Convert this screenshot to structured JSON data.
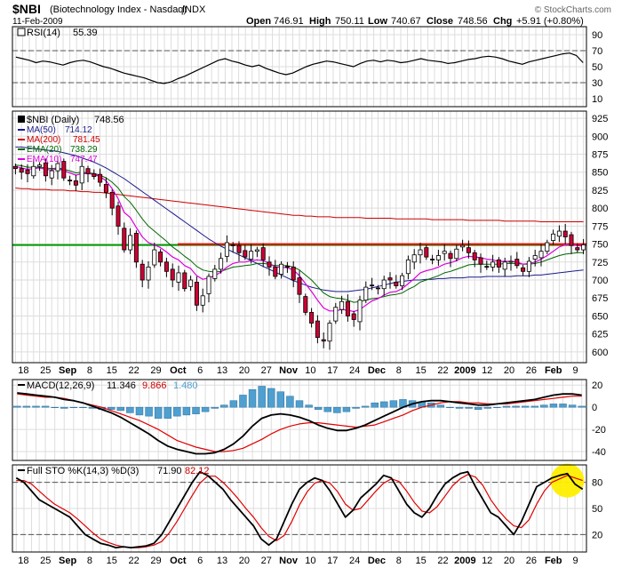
{
  "header": {
    "symbol": "$NBI",
    "name": "(Biotechnology Index - Nasdaq)",
    "exchange": "INDX",
    "date": "11-Feb-2009",
    "open_label": "Open",
    "open": "746.91",
    "high_label": "High",
    "high": "750.11",
    "low_label": "Low",
    "low": "740.67",
    "close_label": "Close",
    "close": "748.56",
    "chg_label": "Chg",
    "chg": "+5.91 (+0.80%)",
    "watermark": "© StockCharts.com",
    "chg_positive": true
  },
  "colors": {
    "ma50": "#1a1a8c",
    "ma200": "#cc0000",
    "ema20": "#006600",
    "ema10": "#dd00dd",
    "hline_green": "#009900",
    "hline_red": "#ff0000",
    "macd_hist": "#4f9fd0",
    "down_candle": "#cc0033",
    "grid": "#dddddd",
    "highlight": "#ffee00"
  },
  "chart_data": [
    {
      "type": "line",
      "panel": "rsi",
      "legend": {
        "label": "RSI(14)",
        "value": "55.39"
      },
      "ylim": [
        0,
        100
      ],
      "yticks": [
        10,
        30,
        50,
        70,
        90
      ],
      "levels": [
        30,
        70
      ],
      "series": [
        {
          "name": "RSI(14)",
          "values": [
            62,
            60,
            58,
            55,
            57,
            56,
            54,
            52,
            55,
            57,
            58,
            56,
            53,
            50,
            48,
            45,
            42,
            40,
            38,
            36,
            33,
            30,
            29,
            31,
            35,
            38,
            42,
            46,
            50,
            54,
            58,
            60,
            57,
            55,
            52,
            50,
            52,
            48,
            45,
            42,
            40,
            42,
            46,
            50,
            53,
            55,
            57,
            56,
            54,
            52,
            50,
            54,
            57,
            58,
            56,
            58,
            57,
            55,
            56,
            58,
            60,
            58,
            57,
            56,
            54,
            55,
            57,
            59,
            60,
            62,
            63,
            62,
            60,
            57,
            55,
            53,
            56,
            58,
            60,
            62,
            64,
            66,
            67,
            64,
            55
          ]
        }
      ]
    },
    {
      "type": "candlestick",
      "panel": "price",
      "legend": [
        {
          "name": "$NBI (Daily)",
          "value": "748.56"
        },
        {
          "name": "MA(50)",
          "value": "714.12"
        },
        {
          "name": "MA(200)",
          "value": "781.45"
        },
        {
          "name": "EMA(20)",
          "value": "738.29"
        },
        {
          "name": "EMA(10)",
          "value": "747.47"
        }
      ],
      "ylim": [
        585,
        935
      ],
      "yticks": [
        600,
        625,
        650,
        675,
        700,
        725,
        750,
        775,
        800,
        825,
        850,
        875,
        900,
        925
      ],
      "hlines": [
        750,
        750
      ],
      "x_labels": [
        "18",
        "25",
        "Sep",
        "8",
        "15",
        "22",
        "29",
        "Oct",
        "6",
        "13",
        "20",
        "27",
        "Nov",
        "10",
        "17",
        "24",
        "Dec",
        "8",
        "15",
        "22",
        "2009",
        "12",
        "20",
        "26",
        "Feb",
        "9"
      ],
      "closes": [
        855,
        850,
        848,
        858,
        860,
        845,
        852,
        862,
        842,
        838,
        832,
        858,
        848,
        844,
        836,
        822,
        800,
        775,
        742,
        762,
        725,
        700,
        718,
        742,
        725,
        712,
        700,
        710,
        688,
        700,
        665,
        678,
        705,
        715,
        730,
        752,
        748,
        738,
        732,
        740,
        742,
        728,
        718,
        705,
        722,
        718,
        700,
        680,
        655,
        640,
        620,
        615,
        640,
        662,
        670,
        650,
        645,
        672,
        690,
        692,
        688,
        700,
        700,
        692,
        706,
        728,
        735,
        742,
        732,
        728,
        734,
        740,
        730,
        743,
        748,
        738,
        728,
        722,
        718,
        725,
        718,
        725,
        726,
        720,
        712,
        726,
        734,
        740,
        752,
        764,
        768,
        760,
        748,
        742,
        749
      ],
      "ma50": [
        885,
        885,
        884,
        883,
        882,
        881,
        880,
        879,
        877,
        875,
        873,
        870,
        867,
        864,
        860,
        856,
        851,
        846,
        841,
        835,
        829,
        823,
        817,
        811,
        805,
        799,
        793,
        787,
        781,
        775,
        769,
        763,
        757,
        752,
        747,
        743,
        739,
        735,
        731,
        727,
        723,
        719,
        715,
        711,
        707,
        703,
        699,
        696,
        693,
        690,
        688,
        686,
        685,
        684,
        684,
        684,
        685,
        686,
        687,
        689,
        691,
        693,
        695,
        697,
        698,
        699,
        700,
        700,
        701,
        701,
        702,
        702,
        703,
        703,
        703,
        704,
        704,
        704,
        705,
        705,
        705,
        705,
        705,
        706,
        706,
        706,
        707,
        707,
        708,
        709,
        710,
        711,
        712,
        713,
        714
      ],
      "ma200": [
        828,
        827,
        827,
        826,
        826,
        826,
        825,
        825,
        825,
        824,
        824,
        823,
        823,
        822,
        822,
        821,
        820,
        819,
        818,
        817,
        816,
        815,
        814,
        813,
        812,
        811,
        810,
        809,
        808,
        807,
        806,
        805,
        804,
        803,
        802,
        801,
        800,
        799,
        798,
        797,
        796,
        795,
        794,
        793,
        792,
        791,
        790,
        790,
        789,
        789,
        788,
        788,
        788,
        787,
        787,
        787,
        787,
        787,
        786,
        786,
        786,
        786,
        786,
        785,
        785,
        785,
        785,
        785,
        785,
        784,
        784,
        784,
        784,
        784,
        784,
        783,
        783,
        783,
        783,
        783,
        783,
        782,
        782,
        782,
        782,
        782,
        782,
        781,
        781,
        781,
        781,
        781,
        781,
        781,
        781
      ],
      "ema20": [
        860,
        859,
        857,
        857,
        857,
        856,
        855,
        856,
        854,
        852,
        849,
        850,
        849,
        848,
        846,
        842,
        836,
        828,
        816,
        808,
        797,
        785,
        775,
        768,
        761,
        754,
        746,
        740,
        733,
        727,
        719,
        714,
        712,
        711,
        712,
        715,
        718,
        719,
        720,
        721,
        723,
        723,
        722,
        720,
        720,
        720,
        718,
        714,
        707,
        700,
        691,
        682,
        677,
        675,
        674,
        672,
        669,
        670,
        672,
        674,
        675,
        677,
        679,
        680,
        682,
        687,
        691,
        697,
        700,
        703,
        706,
        710,
        712,
        715,
        718,
        721,
        722,
        722,
        722,
        722,
        722,
        723,
        723,
        723,
        722,
        722,
        723,
        725,
        728,
        731,
        734,
        736,
        737,
        738,
        738
      ],
      "ema10": [
        858,
        856,
        854,
        855,
        856,
        854,
        853,
        855,
        852,
        849,
        846,
        848,
        848,
        847,
        844,
        838,
        827,
        813,
        794,
        787,
        773,
        760,
        752,
        749,
        745,
        739,
        732,
        728,
        720,
        716,
        706,
        701,
        703,
        706,
        711,
        718,
        723,
        725,
        725,
        727,
        728,
        727,
        723,
        718,
        718,
        717,
        714,
        706,
        695,
        684,
        672,
        661,
        657,
        657,
        659,
        658,
        656,
        659,
        665,
        671,
        674,
        679,
        683,
        684,
        688,
        695,
        702,
        710,
        713,
        715,
        718,
        722,
        724,
        727,
        731,
        733,
        732,
        731,
        729,
        728,
        726,
        726,
        726,
        725,
        722,
        723,
        725,
        729,
        734,
        740,
        746,
        749,
        749,
        748,
        747
      ]
    },
    {
      "type": "line",
      "panel": "macd",
      "legend": {
        "label": "MACD(12,26,9)",
        "macd": "11.346",
        "signal": "9.866",
        "hist": "1.480"
      },
      "ylim": [
        -48,
        25
      ],
      "yticks": [
        -40,
        -20,
        0,
        20
      ],
      "series": [
        {
          "name": "MACD",
          "values": [
            13,
            12,
            11,
            10,
            9,
            7,
            6,
            4,
            1,
            -2,
            -5,
            -9,
            -14,
            -19,
            -24,
            -30,
            -35,
            -38,
            -40,
            -42,
            -42,
            -41,
            -38,
            -33,
            -26,
            -17,
            -10,
            -7,
            -6,
            -7,
            -9,
            -12,
            -16,
            -19,
            -21,
            -21,
            -19,
            -16,
            -12,
            -8,
            -4,
            0,
            3,
            5,
            6,
            6,
            5,
            4,
            3,
            2,
            2,
            3,
            4,
            5,
            6,
            7,
            9,
            11,
            12,
            12,
            11
          ]
        },
        {
          "name": "Signal",
          "values": [
            12,
            11,
            10,
            9,
            9,
            8,
            6,
            4,
            2,
            0,
            -3,
            -6,
            -9,
            -12,
            -16,
            -20,
            -25,
            -30,
            -33,
            -36,
            -38,
            -40,
            -40,
            -39,
            -37,
            -33,
            -29,
            -24,
            -20,
            -17,
            -15,
            -14,
            -14,
            -15,
            -16,
            -17,
            -18,
            -17,
            -16,
            -13,
            -10,
            -7,
            -3,
            0,
            2,
            4,
            5,
            5,
            4,
            4,
            3,
            3,
            3,
            4,
            5,
            6,
            7,
            8,
            9,
            10,
            10
          ]
        }
      ],
      "hist": [
        1,
        1,
        1,
        1,
        0,
        -1,
        0,
        0,
        -1,
        -2,
        -2,
        -3,
        -5,
        -7,
        -8,
        -10,
        -10,
        -8,
        -7,
        -6,
        -4,
        -1,
        2,
        6,
        11,
        16,
        19,
        17,
        14,
        10,
        6,
        2,
        -2,
        -4,
        -5,
        -4,
        -1,
        1,
        4,
        5,
        6,
        7,
        6,
        5,
        4,
        2,
        0,
        -1,
        -1,
        -2,
        -1,
        0,
        1,
        1,
        1,
        1,
        2,
        3,
        3,
        2,
        1
      ]
    },
    {
      "type": "line",
      "panel": "sto",
      "legend": {
        "label": "Full STO %K(14,3) %D(3)",
        "k": "71.90",
        "d": "82.12"
      },
      "ylim": [
        0,
        100
      ],
      "yticks": [
        20,
        50,
        80
      ],
      "series": [
        {
          "name": "%K",
          "values": [
            85,
            80,
            70,
            60,
            55,
            50,
            45,
            40,
            30,
            20,
            15,
            10,
            8,
            5,
            6,
            5,
            6,
            7,
            10,
            20,
            35,
            50,
            65,
            80,
            92,
            88,
            80,
            72,
            60,
            50,
            40,
            30,
            15,
            8,
            15,
            35,
            55,
            72,
            80,
            85,
            82,
            70,
            55,
            40,
            48,
            62,
            70,
            78,
            88,
            85,
            70,
            55,
            45,
            40,
            50,
            65,
            78,
            85,
            90,
            92,
            75,
            60,
            45,
            40,
            30,
            20,
            35,
            55,
            75,
            80,
            85,
            88,
            90,
            78,
            72
          ]
        },
        {
          "name": "%D",
          "values": [
            82,
            82,
            78,
            70,
            62,
            55,
            50,
            45,
            38,
            30,
            22,
            15,
            11,
            8,
            6,
            5,
            5,
            6,
            8,
            12,
            22,
            35,
            50,
            65,
            79,
            87,
            87,
            80,
            71,
            61,
            50,
            40,
            28,
            18,
            13,
            19,
            35,
            54,
            69,
            79,
            82,
            79,
            69,
            55,
            48,
            50,
            60,
            70,
            79,
            84,
            81,
            70,
            57,
            47,
            45,
            52,
            64,
            76,
            84,
            89,
            86,
            76,
            60,
            48,
            38,
            30,
            28,
            37,
            55,
            70,
            80,
            84,
            88,
            85,
            82
          ]
        }
      ],
      "x_labels": [
        "18",
        "25",
        "Sep",
        "8",
        "15",
        "22",
        "29",
        "Oct",
        "6",
        "13",
        "20",
        "27",
        "Nov",
        "10",
        "17",
        "24",
        "Dec",
        "8",
        "15",
        "22",
        "2009",
        "12",
        "20",
        "26",
        "Feb",
        "9"
      ]
    }
  ]
}
